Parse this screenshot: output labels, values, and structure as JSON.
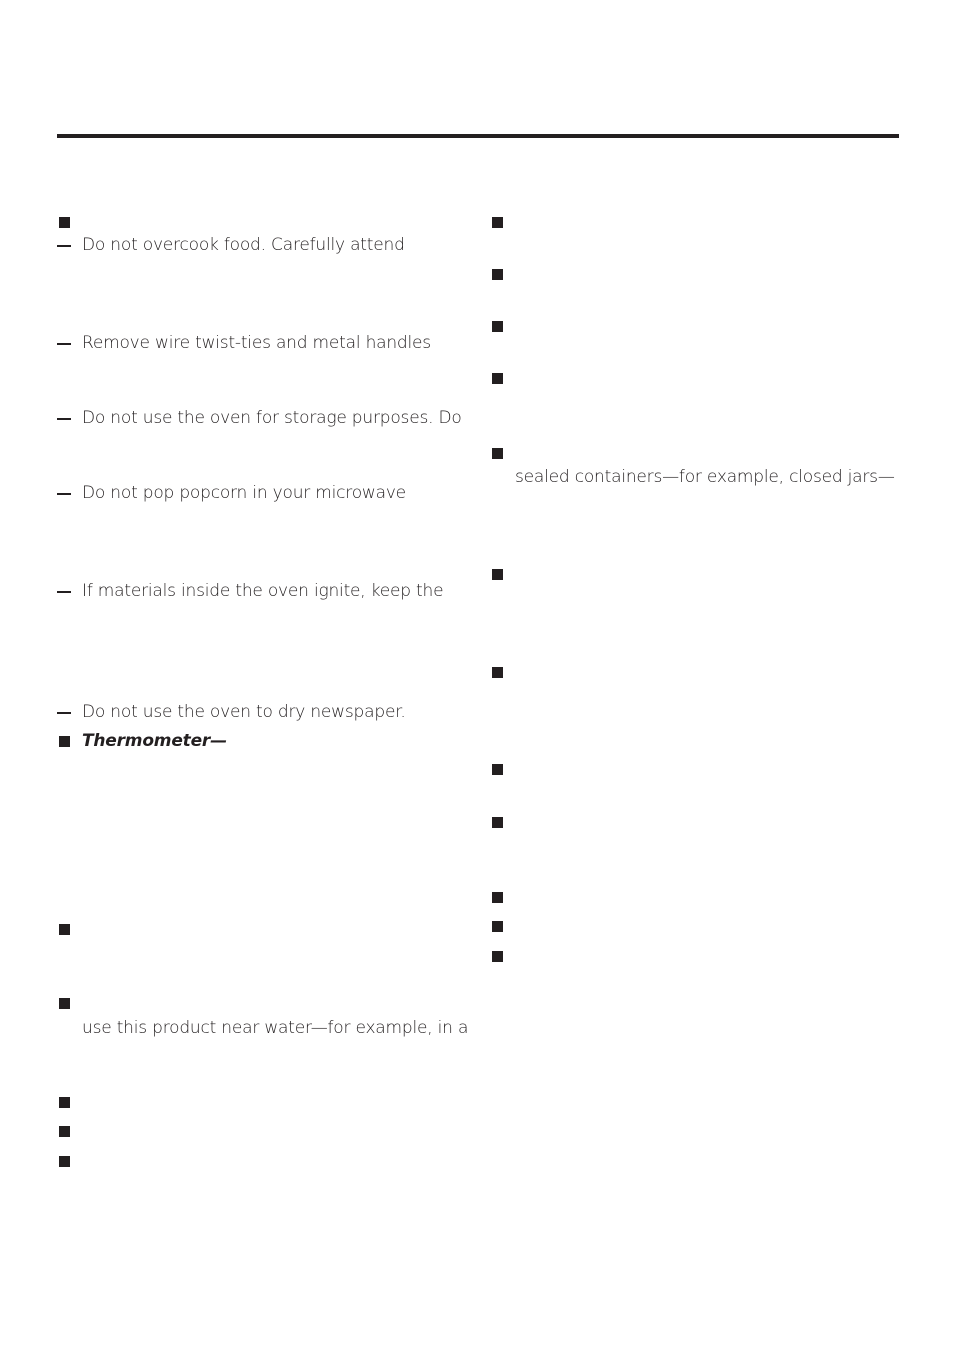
{
  "left_column": {
    "dash_items": [
      "Do not overcook food. Carefully attend",
      "Remove wire twist-ties and metal handles",
      "Do not use the oven for storage purposes. Do",
      "Do not pop popcorn in your microwave",
      "If materials inside the oven ignite, keep the",
      "Do not use the oven to dry newspaper."
    ],
    "thermometer_label": "Thermometer—",
    "water_text": "use this product near water—for example, in a"
  },
  "right_column": {
    "sealed_text": "sealed containers—for example, closed jars—"
  },
  "colors": {
    "text": "#231f20",
    "rule": "#231f20"
  }
}
